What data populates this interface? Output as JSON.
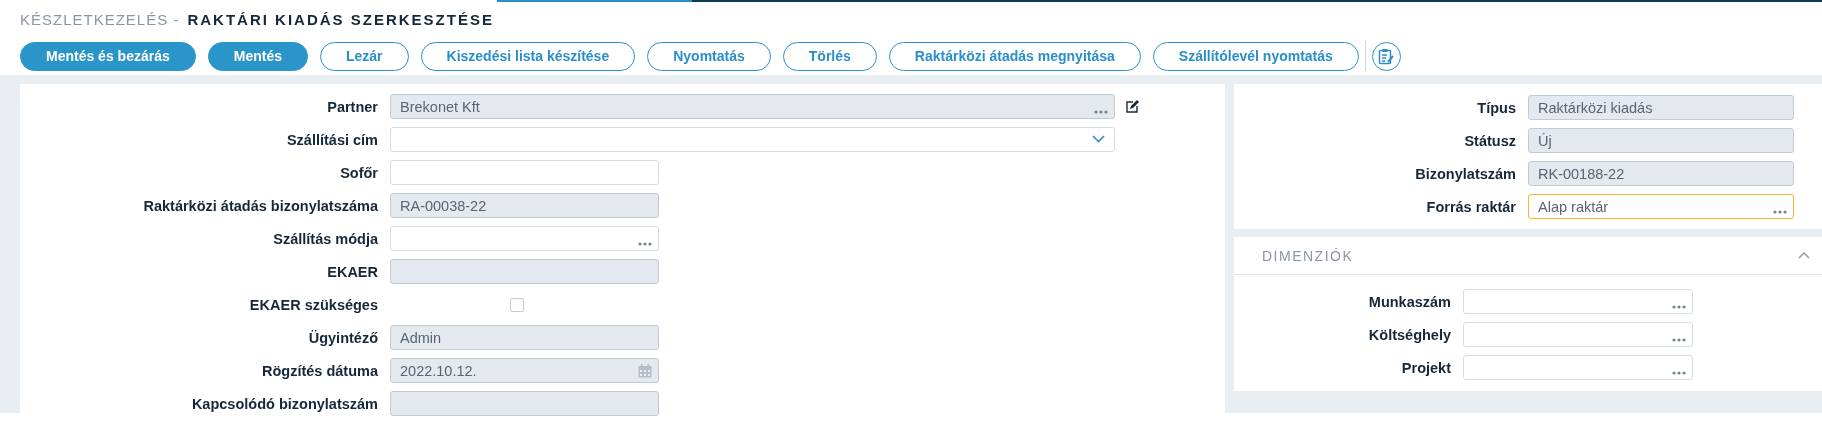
{
  "header": {
    "module": "KÉSZLETKEZELÉS -",
    "title": "RAKTÁRI KIADÁS SZERKESZTÉSE"
  },
  "toolbar": [
    {
      "label": "Mentés és bezárás",
      "kind": "primary"
    },
    {
      "label": "Mentés",
      "kind": "primary"
    },
    {
      "label": "Lezár",
      "kind": "secondary"
    },
    {
      "label": "Kiszedési lista készítése",
      "kind": "secondary"
    },
    {
      "label": "Nyomtatás",
      "kind": "secondary"
    },
    {
      "label": "Törlés",
      "kind": "secondary"
    },
    {
      "label": "Raktárközi átadás megnyitása",
      "kind": "secondary"
    },
    {
      "label": "Szállítólevél nyomtatás",
      "kind": "secondary"
    },
    {
      "kind": "icon"
    }
  ],
  "main_form": {
    "fields": [
      {
        "label": "Partner",
        "kind": "lookup",
        "value": "Brekonet Kft",
        "disabled": true,
        "edit_link": true
      },
      {
        "label": "Szállítási cím",
        "kind": "dropdown",
        "disabled": false
      },
      {
        "label": "Sofőr",
        "kind": "text",
        "disabled": false
      },
      {
        "label": "Raktárközi átadás bizonylatszáma",
        "kind": "text",
        "value": "RA-00038-22",
        "disabled": true
      },
      {
        "label": "Szállítás módja",
        "kind": "lookup",
        "disabled": false
      },
      {
        "label": "EKAER",
        "kind": "text",
        "disabled": true
      },
      {
        "label": "EKAER szükséges",
        "kind": "checkbox",
        "checked": false
      },
      {
        "label": "Ügyintéző",
        "kind": "text",
        "value": "Admin",
        "disabled": true
      },
      {
        "label": "Rögzítés dátuma",
        "kind": "date",
        "value": "2022.10.12.",
        "disabled": true
      },
      {
        "label": "Kapcsolódó bizonylatszám",
        "kind": "text",
        "disabled": true
      }
    ]
  },
  "info_form": {
    "fields": [
      {
        "label": "Típus",
        "kind": "text",
        "value": "Raktárközi kiadás",
        "disabled": true
      },
      {
        "label": "Státusz",
        "kind": "text",
        "value": "Új",
        "disabled": true
      },
      {
        "label": "Bizonylatszám",
        "kind": "text",
        "value": "RK-00188-22",
        "disabled": true
      },
      {
        "label": "Forrás raktár",
        "kind": "lookup",
        "value": "Alap raktár",
        "disabled": false,
        "focused": true
      }
    ]
  },
  "dimensions": {
    "title": "DIMENZIÓK",
    "expanded": true,
    "fields": [
      {
        "label": "Munkaszám",
        "kind": "lookup",
        "disabled": false
      },
      {
        "label": "Költséghely",
        "kind": "lookup",
        "disabled": false
      },
      {
        "label": "Projekt",
        "kind": "lookup",
        "disabled": false
      }
    ]
  }
}
